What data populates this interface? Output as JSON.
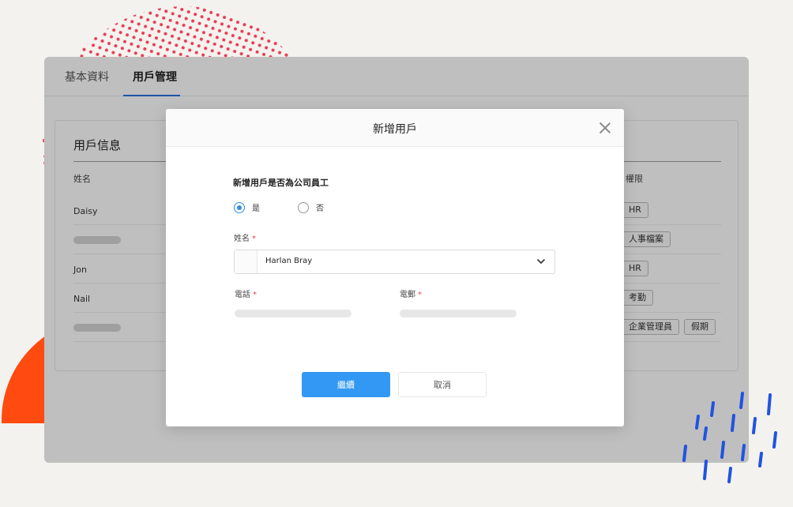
{
  "tabs": [
    {
      "label": "基本資料",
      "active": false
    },
    {
      "label": "用戶管理",
      "active": true
    }
  ],
  "user_card": {
    "title": "用戶信息",
    "columns": {
      "name": "姓名",
      "permissions": "權限"
    },
    "rows": [
      {
        "name": "Daisy",
        "tags": [
          "HR"
        ]
      },
      {
        "name": "",
        "tags": [
          "人事檔案"
        ]
      },
      {
        "name": "Jon",
        "tags": [
          "HR"
        ]
      },
      {
        "name": "Nail",
        "tags": [
          "考勤"
        ]
      },
      {
        "name": "",
        "tags": [
          "企業管理員",
          "假期"
        ]
      }
    ]
  },
  "modal": {
    "title": "新增用戶",
    "question": "新增用戶是否為公司員工",
    "options": [
      {
        "label": "是",
        "selected": true
      },
      {
        "label": "否",
        "selected": false
      }
    ],
    "name_label": "姓名",
    "name_value": "Harlan Bray",
    "phone_label": "電話",
    "email_label": "電郵",
    "required_mark": "*",
    "confirm_label": "繼續",
    "cancel_label": "取消"
  },
  "colors": {
    "accent": "#3398f3",
    "tab_underline": "#2b6de0",
    "required": "#e5484d",
    "deco_dots": "#ec3b55",
    "deco_orange": "#ff4a10",
    "deco_dashes": "#1f54e0"
  },
  "icons": [
    "close-icon",
    "chevron-down-icon",
    "radio-checked-icon",
    "radio-unchecked-icon"
  ]
}
